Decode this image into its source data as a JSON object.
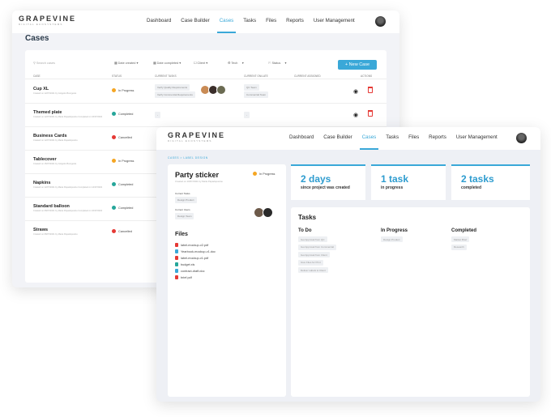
{
  "colors": {
    "accent": "#3aa8d8",
    "in_progress": "#f5a623",
    "completed": "#26a69a",
    "cancelled": "#e53935"
  },
  "logo": {
    "name": "GRAPEVINE",
    "sub": "DIGITAL ECOSYSTEMS"
  },
  "nav": {
    "items": [
      "Dashboard",
      "Case Builder",
      "Cases",
      "Tasks",
      "Files",
      "Reports",
      "User Management"
    ],
    "active": "Cases"
  },
  "cases_page": {
    "title": "Cases",
    "search_placeholder": "Search cases",
    "filters": [
      "Date created",
      "Date completed",
      "Client",
      "Tech",
      "Status"
    ],
    "new_case": "+ New Case",
    "columns": [
      "CASE",
      "STATUS",
      "CURRENT TASKS",
      "CURRENT ON/LATE",
      "CURRENT ASSIGNED",
      "ACTIONS"
    ],
    "rows": [
      {
        "name": "Cup XL",
        "sub": "Created on 12/07/2021 by Grégoire Bourgeois",
        "status": "In Progress",
        "tasks": [
          "Verify Quality Requirements",
          "Verify Commercial Requirements"
        ],
        "teams": [
          "QC Team",
          "Commercial Team"
        ],
        "assigned": 3
      },
      {
        "name": "Themed plate",
        "sub": "Created on 12/07/2021 by Maria Papadopoulou Completed on 16/07/2021",
        "status": "Completed",
        "tasks": [
          "-"
        ],
        "teams": [
          "-"
        ],
        "assigned": 0
      },
      {
        "name": "Business Cards",
        "sub": "Created on 12/07/2021 by Maria Papadopoulou",
        "status": "Cancelled",
        "tasks": [],
        "teams": [],
        "assigned": 0
      },
      {
        "name": "Tablecover",
        "sub": "Created on 15/07/2021 by Grégoire Bourgeois",
        "status": "In Progress",
        "tasks": [],
        "teams": [],
        "assigned": 0
      },
      {
        "name": "Napkins",
        "sub": "Created on 12/07/2021 by Maria Papadopoulou Completed on 14/07/2021",
        "status": "Completed",
        "tasks": [],
        "teams": [],
        "assigned": 0
      },
      {
        "name": "Standard balloon",
        "sub": "Created on 08/07/2021 by Maria Papadopoulou Completed on 10/07/2021",
        "status": "Completed",
        "tasks": [],
        "teams": [],
        "assigned": 0
      },
      {
        "name": "Straws",
        "sub": "Created on 08/07/2021 by Maria Papadopoulou",
        "status": "Cancelled",
        "tasks": [],
        "teams": [],
        "assigned": 0
      }
    ]
  },
  "detail": {
    "breadcrumb": "CASES  >  LABEL DESIGN",
    "name": "Party sticker",
    "sub": "Created on 10/07/2021 by Maria Papadopoulou",
    "status": "In Progress",
    "current_tasks_label": "Current Tasks",
    "current_task": "Design Product",
    "current_users_label": "Current Users",
    "current_team": "Design Team",
    "files_title": "Files",
    "files": [
      {
        "name": "label-mockup-v2.pdf",
        "kind": "pdf"
      },
      {
        "name": "Yearbook-mockup-v1.doc",
        "kind": "doc"
      },
      {
        "name": "label-mockup-v1.pdf",
        "kind": "pdf"
      },
      {
        "name": "budget.xls",
        "kind": "xls"
      },
      {
        "name": "contract-draft.doc",
        "kind": "doc"
      },
      {
        "name": "brief.pdf",
        "kind": "pdf"
      }
    ],
    "stats": [
      {
        "value": "2 days",
        "label": "since project was created"
      },
      {
        "value": "1 task",
        "label": "in progress"
      },
      {
        "value": "2 tasks",
        "label": "completed"
      }
    ],
    "tasks_title": "Tasks",
    "todo_title": "To Do",
    "todo": [
      "Get Approval from QC",
      "Get Approval from Commercial",
      "Get Approval from Client",
      "Give Files for Print",
      "Deliver Labels to Client"
    ],
    "inprogress_title": "In Progress",
    "inprogress": [
      "Design Product"
    ],
    "completed_title": "Completed",
    "completed": [
      "Market Brief",
      "Research"
    ]
  }
}
